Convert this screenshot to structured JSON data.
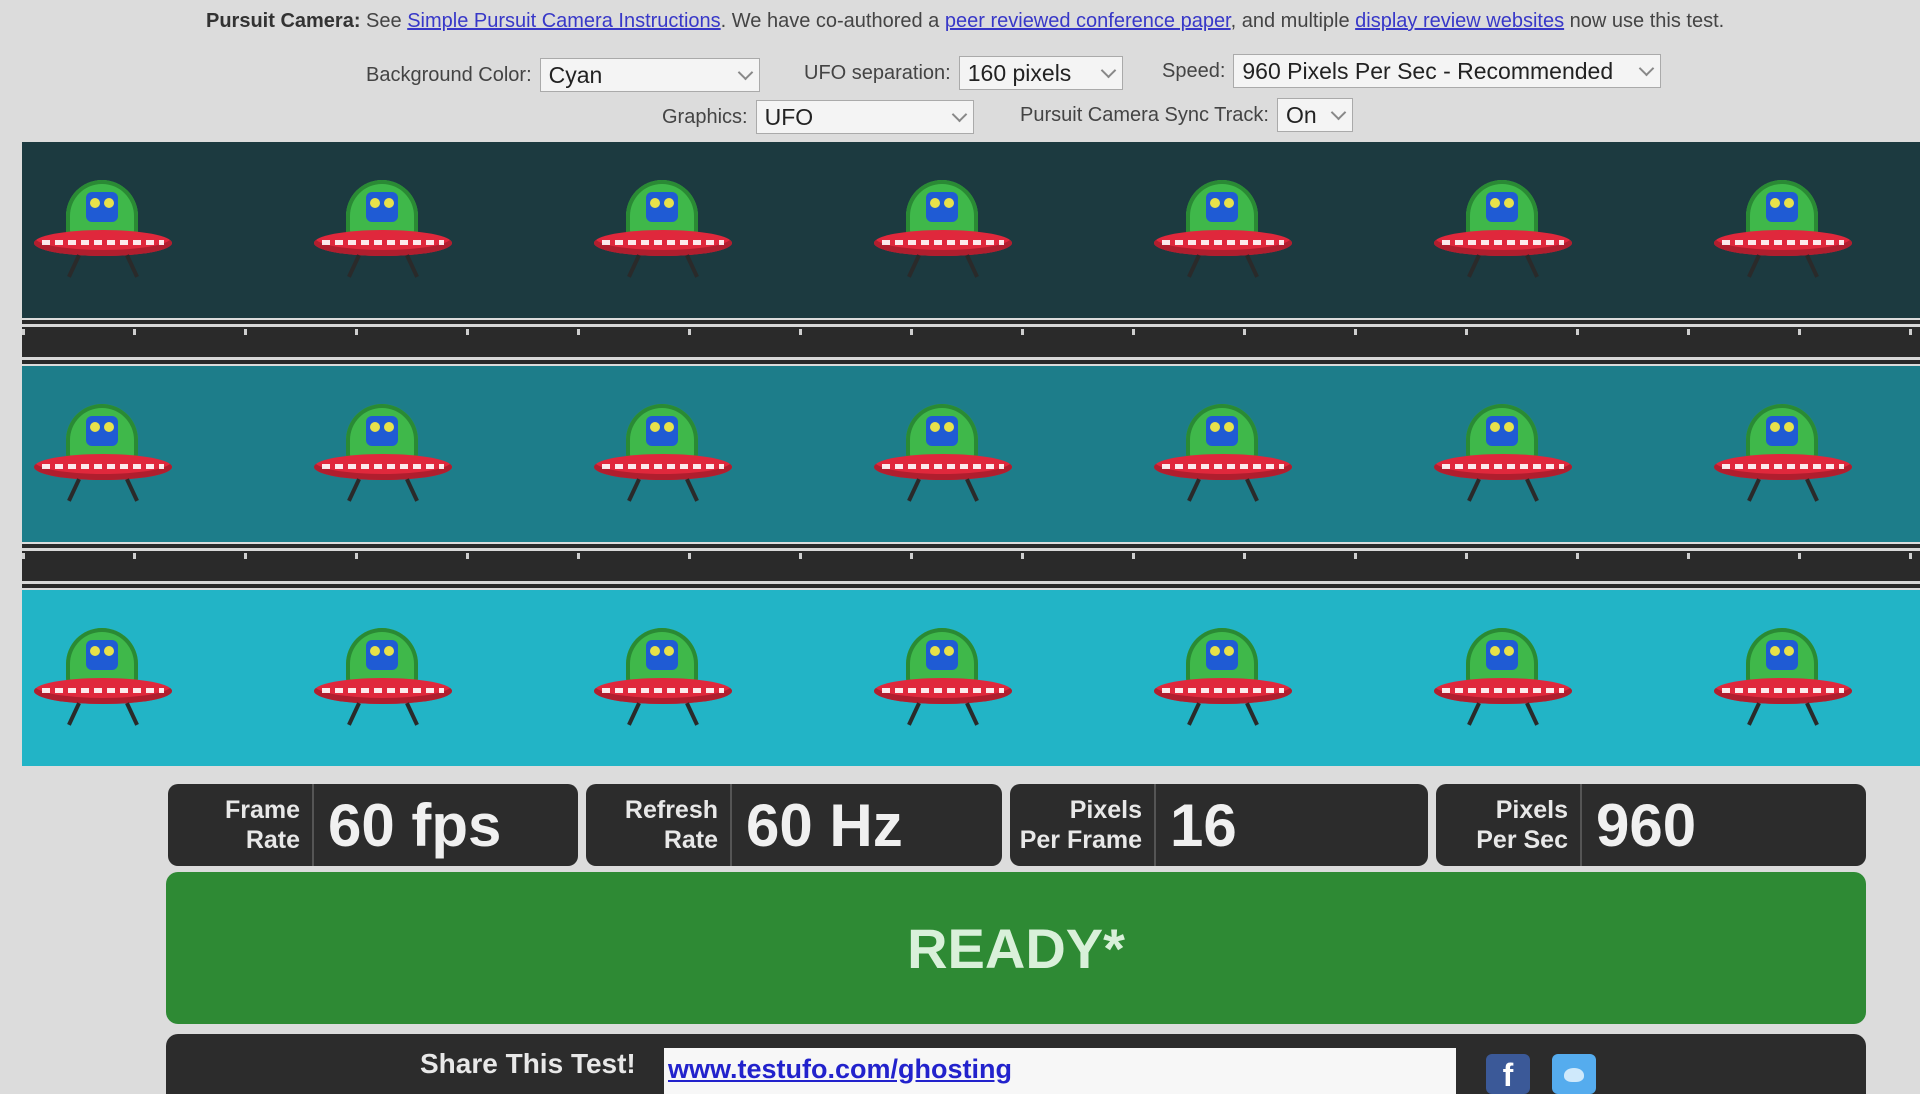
{
  "info": {
    "lead": "Pursuit Camera:",
    "see": " See ",
    "link1": "Simple Pursuit Camera Instructions",
    "mid1": ". We have co-authored a ",
    "link2": "peer reviewed conference paper",
    "mid2": ", and multiple ",
    "link3": "display review websites",
    "tail": " now use this test."
  },
  "controls": {
    "background_color": {
      "label": "Background Color:",
      "value": "Cyan"
    },
    "ufo_separation": {
      "label": "UFO separation:",
      "value": "160 pixels"
    },
    "speed": {
      "label": "Speed:",
      "value": "960 Pixels Per Sec - Recommended"
    },
    "graphics": {
      "label": "Graphics:",
      "value": "UFO"
    },
    "sync_track": {
      "label": "Pursuit Camera Sync Track:",
      "value": "On"
    }
  },
  "lanes": [
    {
      "color": "#1c3a40",
      "ufo_count": 7
    },
    {
      "color": "#1d7d8a",
      "ufo_count": 7
    },
    {
      "color": "#22b4c6",
      "ufo_count": 7
    }
  ],
  "stats": {
    "frame_rate": {
      "label_line1": "Frame",
      "label_line2": "Rate",
      "value": "60 fps"
    },
    "refresh_rate": {
      "label_line1": "Refresh",
      "label_line2": "Rate",
      "value": "60 Hz"
    },
    "pixels_per_frame": {
      "label_line1": "Pixels",
      "label_line2": "Per Frame",
      "value": "16"
    },
    "pixels_per_sec": {
      "label_line1": "Pixels",
      "label_line2": "Per Sec",
      "value": "960"
    }
  },
  "status": {
    "text": "READY*",
    "color": "#2e8a34"
  },
  "share": {
    "label": "Share This Test!",
    "url": "www.testufo.com/ghosting",
    "facebook_icon": "facebook-icon",
    "twitter_icon": "twitter-icon"
  }
}
